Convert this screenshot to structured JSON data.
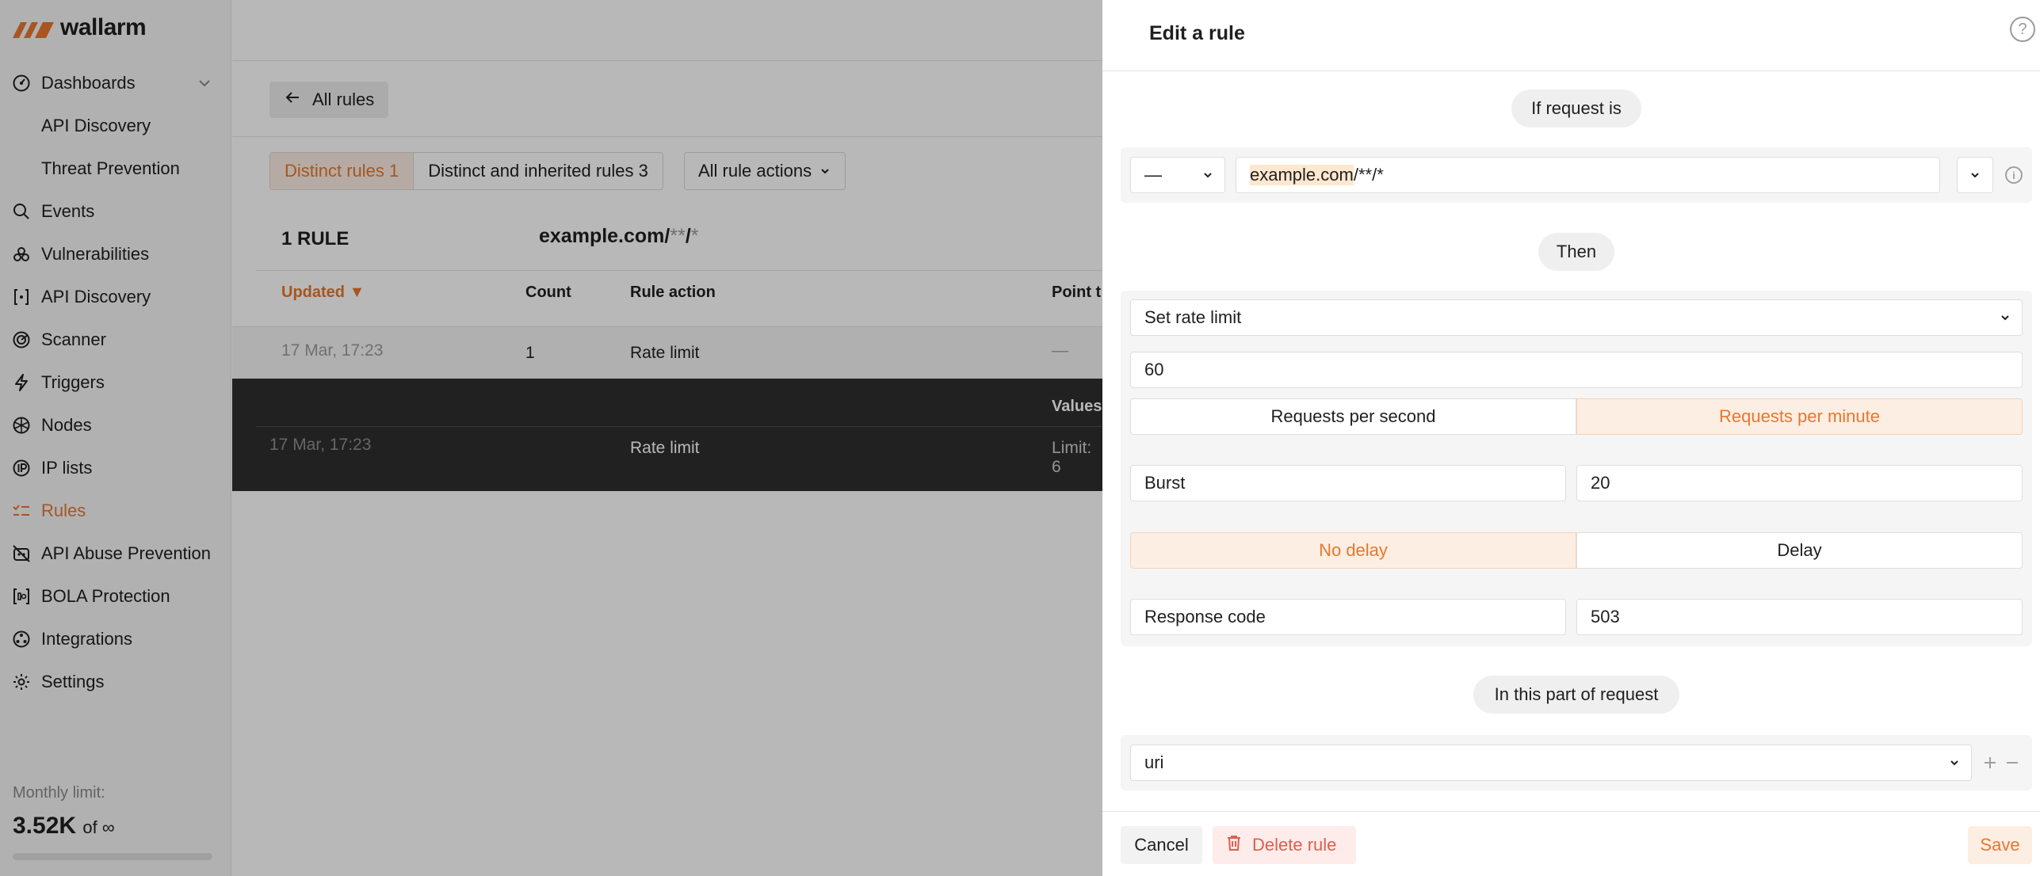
{
  "sidebar": {
    "logo_text": "wallarm",
    "items": [
      {
        "label": "Dashboards",
        "icon": "dashboard-icon"
      },
      {
        "label": "API Discovery",
        "icon": ""
      },
      {
        "label": "Threat Prevention",
        "icon": ""
      },
      {
        "label": "Events",
        "icon": "search-icon"
      },
      {
        "label": "Vulnerabilities",
        "icon": "biohazard-icon"
      },
      {
        "label": "API Discovery",
        "icon": "api-brackets-icon"
      },
      {
        "label": "Scanner",
        "icon": "scanner-icon"
      },
      {
        "label": "Triggers",
        "icon": "bolt-icon"
      },
      {
        "label": "Nodes",
        "icon": "nodes-icon"
      },
      {
        "label": "IP lists",
        "icon": "ip-icon"
      },
      {
        "label": "Rules",
        "icon": "rules-icon"
      },
      {
        "label": "API Abuse Prevention",
        "icon": "robot-icon"
      },
      {
        "label": "BOLA Protection",
        "icon": "bola-icon"
      },
      {
        "label": "Integrations",
        "icon": "integrations-icon"
      },
      {
        "label": "Settings",
        "icon": "gear-icon"
      }
    ],
    "monthly_label": "Monthly limit:",
    "monthly_value": "3.52K",
    "monthly_of": "of ∞",
    "accent": "#e8772e"
  },
  "main": {
    "back_label": "All rules",
    "tabs": [
      "Distinct rules 1",
      "Distinct and inherited rules 3"
    ],
    "actions_select": "All rule actions",
    "rule_count": "1 RULE",
    "rule_path_host": "example.com/",
    "rule_path_glob1": "**",
    "rule_path_sep": "/",
    "rule_path_glob2": "*",
    "columns": [
      "Updated ▼",
      "Count",
      "Rule action",
      "Point t"
    ],
    "row": {
      "updated": "17 Mar, 17:23",
      "count": "1",
      "action": "Rate limit",
      "point": "—"
    },
    "expanded": {
      "values_header": "Values",
      "updated": "17 Mar, 17:23",
      "action": "Rate limit",
      "values": "Limit: 6"
    }
  },
  "drawer": {
    "title": "Edit a rule",
    "if_label": "If request is",
    "method_value": "—",
    "url_host": "example.com",
    "url_rest": "/**/*",
    "then_label": "Then",
    "action_value": "Set rate limit",
    "rate_value": "60",
    "unit_options": [
      "Requests per second",
      "Requests per minute"
    ],
    "burst_label": "Burst",
    "burst_value": "20",
    "delay_options": [
      "No delay",
      "Delay"
    ],
    "response_label": "Response code",
    "response_value": "503",
    "part_label": "In this part of request",
    "part_value": "uri",
    "cancel_label": "Cancel",
    "delete_label": "Delete rule",
    "save_label": "Save"
  }
}
